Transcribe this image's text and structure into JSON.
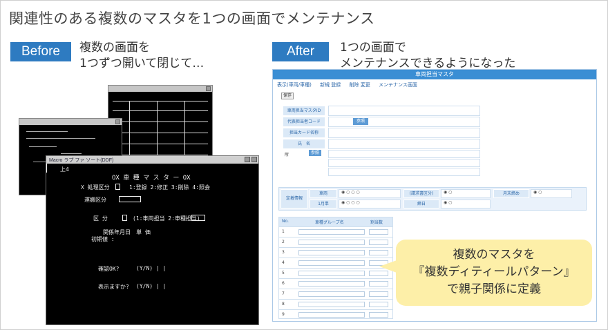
{
  "title": "関連性のある複数のマスタを1つの画面でメンテナンス",
  "before": {
    "badge": "Before",
    "caption_line1": "複数の画面を",
    "caption_line2": "1つずつ開いて閉じて…",
    "big_window_title": "Macro ラプ ファ ソート(DDF)",
    "screen_label": "上4",
    "screen_title": "OX  車 種 マ ス タ ー  OX",
    "field_1": "X 処理区分",
    "field_2": "運搬区分",
    "field_3": "区  分",
    "field_4": "関係年月日",
    "field_5": "初期値 :",
    "confirm_1": "確認OK?",
    "confirm_2": "表示ますか?"
  },
  "after": {
    "badge": "After",
    "caption_line1": "1つの画面で",
    "caption_line2": "メンテナンスできるようになった",
    "window_title": "車両担当マスタ",
    "toolbar": [
      "表示(車両/車種)",
      "新規 登録",
      "削除 変更",
      "メンテナンス画面"
    ],
    "button_save": "保存",
    "labels": [
      "車両担当マスタID",
      "代表担当者コード",
      "担当カード名称",
      "氏　名",
      "所"
    ],
    "ref_button": "参照",
    "section2_label": "定着情報",
    "section2_items": [
      "車両",
      "1月単",
      "(請求書区分)",
      "締日",
      "月末締め"
    ],
    "table_headers": [
      "No.",
      "車種グループ名",
      "割当数"
    ],
    "row_numbers": [
      "1",
      "2",
      "3",
      "4",
      "5",
      "6",
      "7",
      "8",
      "9"
    ]
  },
  "callout": {
    "line1": "複数のマスタを",
    "line2": "『複数ディティールパターン』",
    "line3": "で親子関係に定義"
  },
  "colors": {
    "accent": "#2e7bc1",
    "callout": "#fdefa8",
    "header_blue": "#3a8ed4"
  }
}
